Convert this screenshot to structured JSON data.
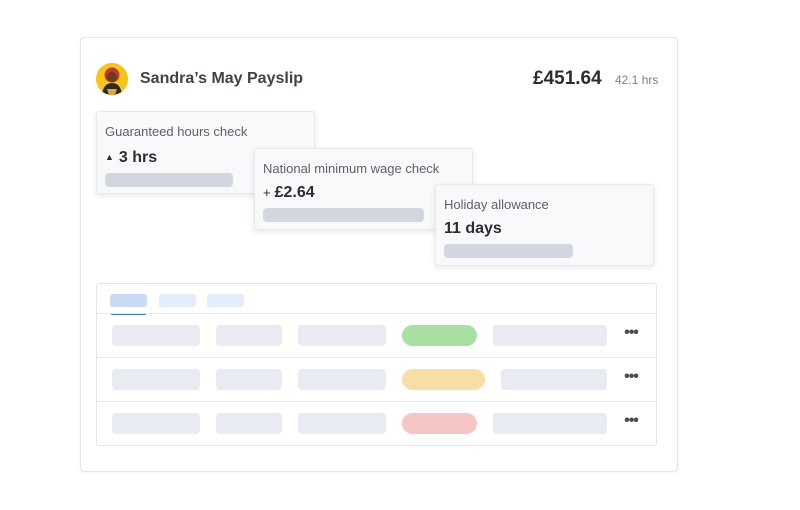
{
  "header": {
    "title": "Sandra’s May Payslip",
    "amount": "£451.64",
    "hours": "42.1 hrs",
    "avatar_icon": "person-avatar-icon"
  },
  "cards": [
    {
      "title": "Guaranteed hours check",
      "value_prefix": "▲",
      "value": "3 hrs"
    },
    {
      "title": "National minimum wage check",
      "value_prefix": "+",
      "value": "£2.64"
    },
    {
      "title": "Holiday allowance",
      "value_prefix": "",
      "value": "11 days"
    }
  ],
  "table": {
    "tab_colors": [
      "#c9daf5",
      "#e3edfb",
      "#e3edfb"
    ],
    "rows": [
      {
        "status_color": "#a8e0a2",
        "more_icon": "more-horizontal-icon",
        "more_label": "•••"
      },
      {
        "status_color": "#f8dea6",
        "more_icon": "more-horizontal-icon",
        "more_label": "•••"
      },
      {
        "status_color": "#f6c6c6",
        "more_icon": "more-horizontal-icon",
        "more_label": "•••"
      }
    ]
  },
  "colors": {
    "accent": "#3f74c4",
    "avatar_bg": "#f5c518",
    "skeleton": "#e8ecf2",
    "card_bar": "#d2d6de"
  }
}
